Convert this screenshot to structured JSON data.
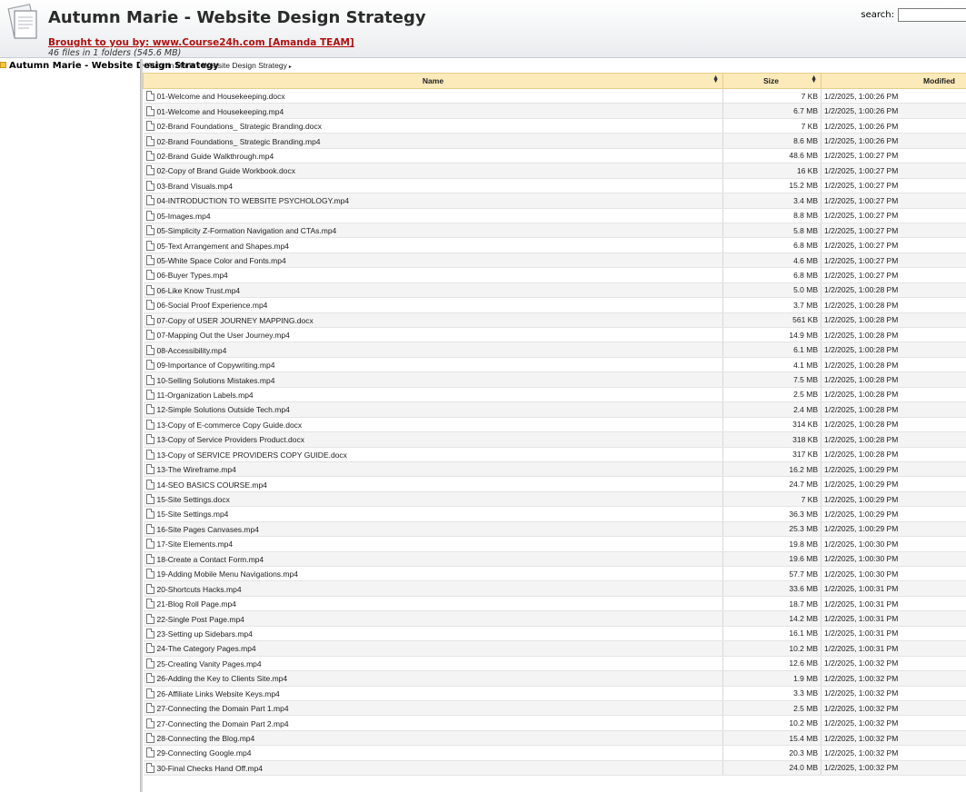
{
  "header": {
    "title": "Autumn Marie - Website Design Strategy",
    "promo_link": "Brought to you by: www.Course24h.com [Amanda TEAM]",
    "summary": "46 files in 1 folders (545.6 MB)",
    "search_label": "search:",
    "search_value": ""
  },
  "sidebar": {
    "tree_item": "Autumn Marie - Website Design Strategy"
  },
  "breadcrumb": {
    "path": "Autumn Marie - Website Design Strategy",
    "arrow": "▸"
  },
  "table": {
    "columns": {
      "name": "Name",
      "size": "Size",
      "modified": "Modified"
    },
    "rows": [
      {
        "name": "01-Welcome and Housekeeping.docx",
        "size": "7 KB",
        "modified": "1/2/2025, 1:00:26 PM"
      },
      {
        "name": "01-Welcome and Housekeeping.mp4",
        "size": "6.7 MB",
        "modified": "1/2/2025, 1:00:26 PM"
      },
      {
        "name": "02-Brand Foundations_ Strategic Branding.docx",
        "size": "7 KB",
        "modified": "1/2/2025, 1:00:26 PM"
      },
      {
        "name": "02-Brand Foundations_ Strategic Branding.mp4",
        "size": "8.6 MB",
        "modified": "1/2/2025, 1:00:26 PM"
      },
      {
        "name": "02-Brand Guide Walkthrough.mp4",
        "size": "48.6 MB",
        "modified": "1/2/2025, 1:00:27 PM"
      },
      {
        "name": "02-Copy of Brand Guide Workbook.docx",
        "size": "16 KB",
        "modified": "1/2/2025, 1:00:27 PM"
      },
      {
        "name": "03-Brand Visuals.mp4",
        "size": "15.2 MB",
        "modified": "1/2/2025, 1:00:27 PM"
      },
      {
        "name": "04-INTRODUCTION TO WEBSITE PSYCHOLOGY.mp4",
        "size": "3.4 MB",
        "modified": "1/2/2025, 1:00:27 PM"
      },
      {
        "name": "05-Images.mp4",
        "size": "8.8 MB",
        "modified": "1/2/2025, 1:00:27 PM"
      },
      {
        "name": "05-Simplicity Z-Formation Navigation and CTAs.mp4",
        "size": "5.8 MB",
        "modified": "1/2/2025, 1:00:27 PM"
      },
      {
        "name": "05-Text Arrangement and Shapes.mp4",
        "size": "6.8 MB",
        "modified": "1/2/2025, 1:00:27 PM"
      },
      {
        "name": "05-White Space Color and Fonts.mp4",
        "size": "4.6 MB",
        "modified": "1/2/2025, 1:00:27 PM"
      },
      {
        "name": "06-Buyer Types.mp4",
        "size": "6.8 MB",
        "modified": "1/2/2025, 1:00:27 PM"
      },
      {
        "name": "06-Like Know Trust.mp4",
        "size": "5.0 MB",
        "modified": "1/2/2025, 1:00:28 PM"
      },
      {
        "name": "06-Social Proof Experience.mp4",
        "size": "3.7 MB",
        "modified": "1/2/2025, 1:00:28 PM"
      },
      {
        "name": "07-Copy of USER JOURNEY MAPPING.docx",
        "size": "561 KB",
        "modified": "1/2/2025, 1:00:28 PM"
      },
      {
        "name": "07-Mapping Out the User Journey.mp4",
        "size": "14.9 MB",
        "modified": "1/2/2025, 1:00:28 PM"
      },
      {
        "name": "08-Accessibility.mp4",
        "size": "6.1 MB",
        "modified": "1/2/2025, 1:00:28 PM"
      },
      {
        "name": "09-Importance of Copywriting.mp4",
        "size": "4.1 MB",
        "modified": "1/2/2025, 1:00:28 PM"
      },
      {
        "name": "10-Selling Solutions Mistakes.mp4",
        "size": "7.5 MB",
        "modified": "1/2/2025, 1:00:28 PM"
      },
      {
        "name": "11-Organization Labels.mp4",
        "size": "2.5 MB",
        "modified": "1/2/2025, 1:00:28 PM"
      },
      {
        "name": "12-Simple Solutions Outside Tech.mp4",
        "size": "2.4 MB",
        "modified": "1/2/2025, 1:00:28 PM"
      },
      {
        "name": "13-Copy of E-commerce Copy Guide.docx",
        "size": "314 KB",
        "modified": "1/2/2025, 1:00:28 PM"
      },
      {
        "name": "13-Copy of Service Providers Product.docx",
        "size": "318 KB",
        "modified": "1/2/2025, 1:00:28 PM"
      },
      {
        "name": "13-Copy of SERVICE PROVIDERS COPY GUIDE.docx",
        "size": "317 KB",
        "modified": "1/2/2025, 1:00:28 PM"
      },
      {
        "name": "13-The Wireframe.mp4",
        "size": "16.2 MB",
        "modified": "1/2/2025, 1:00:29 PM"
      },
      {
        "name": "14-SEO BASICS COURSE.mp4",
        "size": "24.7 MB",
        "modified": "1/2/2025, 1:00:29 PM"
      },
      {
        "name": "15-Site Settings.docx",
        "size": "7 KB",
        "modified": "1/2/2025, 1:00:29 PM"
      },
      {
        "name": "15-Site Settings.mp4",
        "size": "36.3 MB",
        "modified": "1/2/2025, 1:00:29 PM"
      },
      {
        "name": "16-Site Pages Canvases.mp4",
        "size": "25.3 MB",
        "modified": "1/2/2025, 1:00:29 PM"
      },
      {
        "name": "17-Site Elements.mp4",
        "size": "19.8 MB",
        "modified": "1/2/2025, 1:00:30 PM"
      },
      {
        "name": "18-Create a Contact Form.mp4",
        "size": "19.6 MB",
        "modified": "1/2/2025, 1:00:30 PM"
      },
      {
        "name": "19-Adding Mobile Menu Navigations.mp4",
        "size": "57.7 MB",
        "modified": "1/2/2025, 1:00:30 PM"
      },
      {
        "name": "20-Shortcuts Hacks.mp4",
        "size": "33.6 MB",
        "modified": "1/2/2025, 1:00:31 PM"
      },
      {
        "name": "21-Blog Roll Page.mp4",
        "size": "18.7 MB",
        "modified": "1/2/2025, 1:00:31 PM"
      },
      {
        "name": "22-Single Post Page.mp4",
        "size": "14.2 MB",
        "modified": "1/2/2025, 1:00:31 PM"
      },
      {
        "name": "23-Setting up Sidebars.mp4",
        "size": "16.1 MB",
        "modified": "1/2/2025, 1:00:31 PM"
      },
      {
        "name": "24-The Category Pages.mp4",
        "size": "10.2 MB",
        "modified": "1/2/2025, 1:00:31 PM"
      },
      {
        "name": "25-Creating Vanity Pages.mp4",
        "size": "12.6 MB",
        "modified": "1/2/2025, 1:00:32 PM"
      },
      {
        "name": "26-Adding the Key to Clients Site.mp4",
        "size": "1.9 MB",
        "modified": "1/2/2025, 1:00:32 PM"
      },
      {
        "name": "26-Affiliate Links Website Keys.mp4",
        "size": "3.3 MB",
        "modified": "1/2/2025, 1:00:32 PM"
      },
      {
        "name": "27-Connecting the Domain Part 1.mp4",
        "size": "2.5 MB",
        "modified": "1/2/2025, 1:00:32 PM"
      },
      {
        "name": "27-Connecting the Domain Part 2.mp4",
        "size": "10.2 MB",
        "modified": "1/2/2025, 1:00:32 PM"
      },
      {
        "name": "28-Connecting the Blog.mp4",
        "size": "15.4 MB",
        "modified": "1/2/2025, 1:00:32 PM"
      },
      {
        "name": "29-Connecting Google.mp4",
        "size": "20.3 MB",
        "modified": "1/2/2025, 1:00:32 PM"
      },
      {
        "name": "30-Final Checks Hand Off.mp4",
        "size": "24.0 MB",
        "modified": "1/2/2025, 1:00:32 PM"
      }
    ]
  }
}
